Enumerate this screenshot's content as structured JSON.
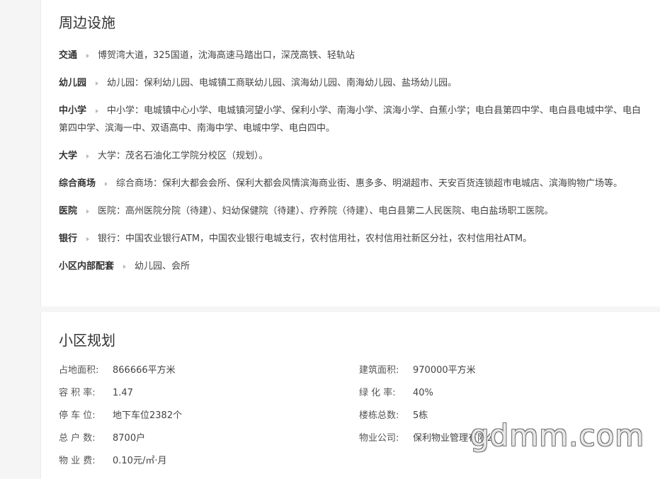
{
  "facilities": {
    "title": "周边设施",
    "items": [
      {
        "key": "交通",
        "value": "博贺湾大道，325国道，沈海高速马踏出口，深茂高铁、轻轨站"
      },
      {
        "key": "幼儿园",
        "value": "幼儿园：保利幼儿园、电城镇工商联幼儿园、滨海幼儿园、南海幼儿园、盐场幼儿园。"
      },
      {
        "key": "中小学",
        "value": "中小学：电城镇中心小学、电城镇河望小学、保利小学、南海小学、滨海小学、白蕉小学；电白县第四中学、电白县电城中学、电白第四中学、滨海一中、双语高中、南海中学、电城中学、电白四中。"
      },
      {
        "key": "大学",
        "value": "大学：茂名石油化工学院分校区（规划）。"
      },
      {
        "key": "综合商场",
        "value": "综合商场：保利大都会会所、保利大都会风情滨海商业街、惠多多、明湖超市、天安百货连锁超市电城店、滨海购物广场等。"
      },
      {
        "key": "医院",
        "value": "医院：高州医院分院（待建）、妇幼保健院（待建）、疗养院（待建）、电白县第二人民医院、电白盐场职工医院。"
      },
      {
        "key": "银行",
        "value": "银行：中国农业银行ATM，中国农业银行电城支行，农村信用社，农村信用社新区分社，农村信用社ATM。"
      },
      {
        "key": "小区内部配套",
        "value": "幼儿园、会所"
      }
    ]
  },
  "plan": {
    "title": "小区规划",
    "rows": [
      {
        "left": {
          "label": "占地面积:",
          "value": "866666平方米"
        },
        "right": {
          "label": "建筑面积:",
          "value": "970000平方米"
        }
      },
      {
        "left": {
          "label": "容 积 率:",
          "value": "1.47"
        },
        "right": {
          "label": "绿 化 率:",
          "value": "40%"
        }
      },
      {
        "left": {
          "label": "停 车 位:",
          "value": "地下车位2382个"
        },
        "right": {
          "label": "楼栋总数:",
          "value": "5栋"
        }
      },
      {
        "left": {
          "label": "总 户 数:",
          "value": "8700户"
        },
        "right": {
          "label": "物业公司:",
          "value": "保利物业管理有限公"
        }
      },
      {
        "left": {
          "label": "物 业 费:",
          "value": "0.10元/㎡·月"
        }
      }
    ]
  },
  "watermark": "gdmm.com"
}
